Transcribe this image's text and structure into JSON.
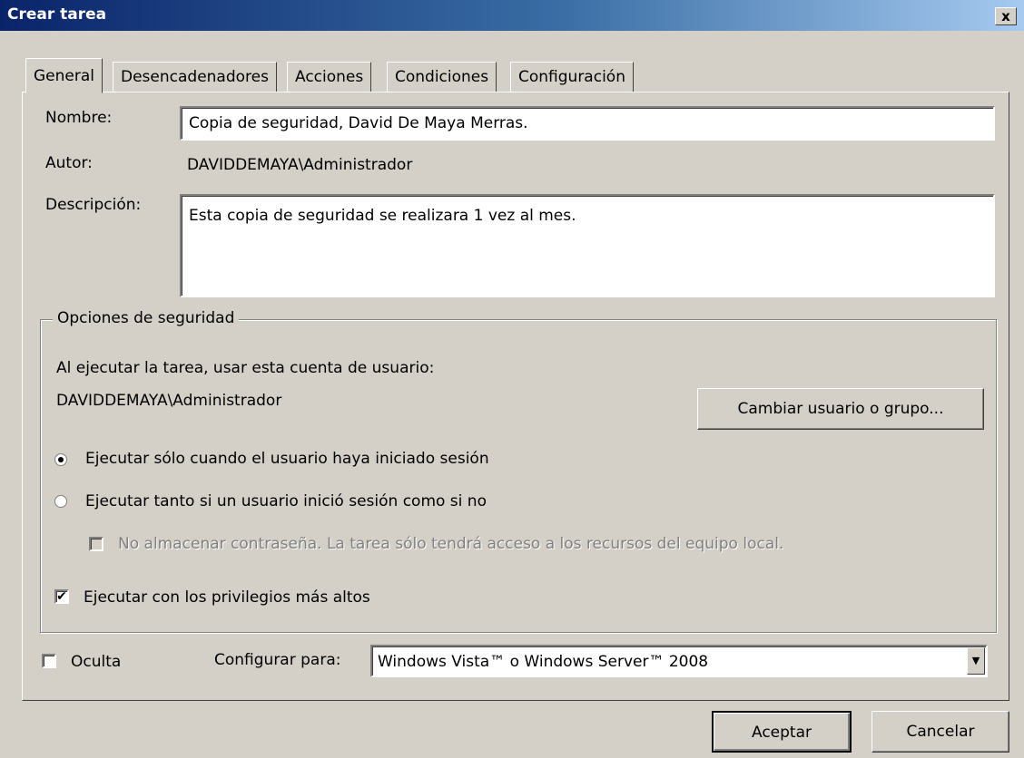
{
  "window": {
    "title": "Crear tarea",
    "close_glyph": "x"
  },
  "tabs": [
    "General",
    "Desencadenadores",
    "Acciones",
    "Condiciones",
    "Configuración"
  ],
  "general": {
    "name_label": "Nombre:",
    "name_value": "Copia de seguridad, David De Maya Merras.",
    "author_label": "Autor:",
    "author_value": "DAVIDDEMAYA\\Administrador",
    "description_label": "Descripción:",
    "description_value": "Esta copia de seguridad se realizara 1 vez al mes."
  },
  "security": {
    "group_label": "Opciones de seguridad",
    "account_prompt": "Al ejecutar la tarea, usar esta cuenta de usuario:",
    "account_value": "DAVIDDEMAYA\\Administrador",
    "change_user_button": "Cambiar usuario o grupo...",
    "radio_logged_on": "Ejecutar sólo cuando el usuario haya iniciado sesión",
    "radio_logged_on_selected": true,
    "radio_always": "Ejecutar tanto si un usuario inició sesión como si no",
    "radio_always_selected": false,
    "no_store_password": "No almacenar contraseña. La tarea sólo tendrá acceso a los recursos del equipo local.",
    "no_store_password_checked": false,
    "no_store_password_enabled": false,
    "highest_privileges": "Ejecutar con los privilegios más altos",
    "highest_privileges_checked": true
  },
  "footer_options": {
    "hidden_label": "Oculta",
    "hidden_checked": false,
    "configure_label": "Configurar para:",
    "configure_value": "Windows Vista™ o Windows Server™ 2008"
  },
  "buttons": {
    "ok": "Aceptar",
    "cancel": "Cancelar"
  },
  "glyphs": {
    "checkmark": "✔",
    "dropdown_arrow": "▼"
  },
  "colors": {
    "face": "#d4d0c8",
    "title_start": "#0a246a",
    "title_end": "#a6caf0",
    "disabled_text": "#808080"
  }
}
